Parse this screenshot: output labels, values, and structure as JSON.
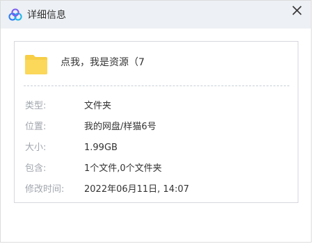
{
  "window": {
    "title": "详细信息"
  },
  "file": {
    "name": "点我，我是资源（7"
  },
  "properties": [
    {
      "label": "类型:",
      "value": "文件夹"
    },
    {
      "label": "位置:",
      "value": "我的网盘/样猫6号"
    },
    {
      "label": "大小:",
      "value": "1.99GB"
    },
    {
      "label": "包含:",
      "value": "1个文件,0个文件夹"
    },
    {
      "label": "修改时间:",
      "value": "2022年06月11日, 14:07"
    }
  ],
  "icons": {
    "app": "cloud-logo-icon",
    "close": "close-icon",
    "file": "folder-icon"
  },
  "colors": {
    "titlebar": "#edf0f4",
    "folder": "#f7ce46",
    "label": "#a1a6ad",
    "text": "#333333"
  }
}
